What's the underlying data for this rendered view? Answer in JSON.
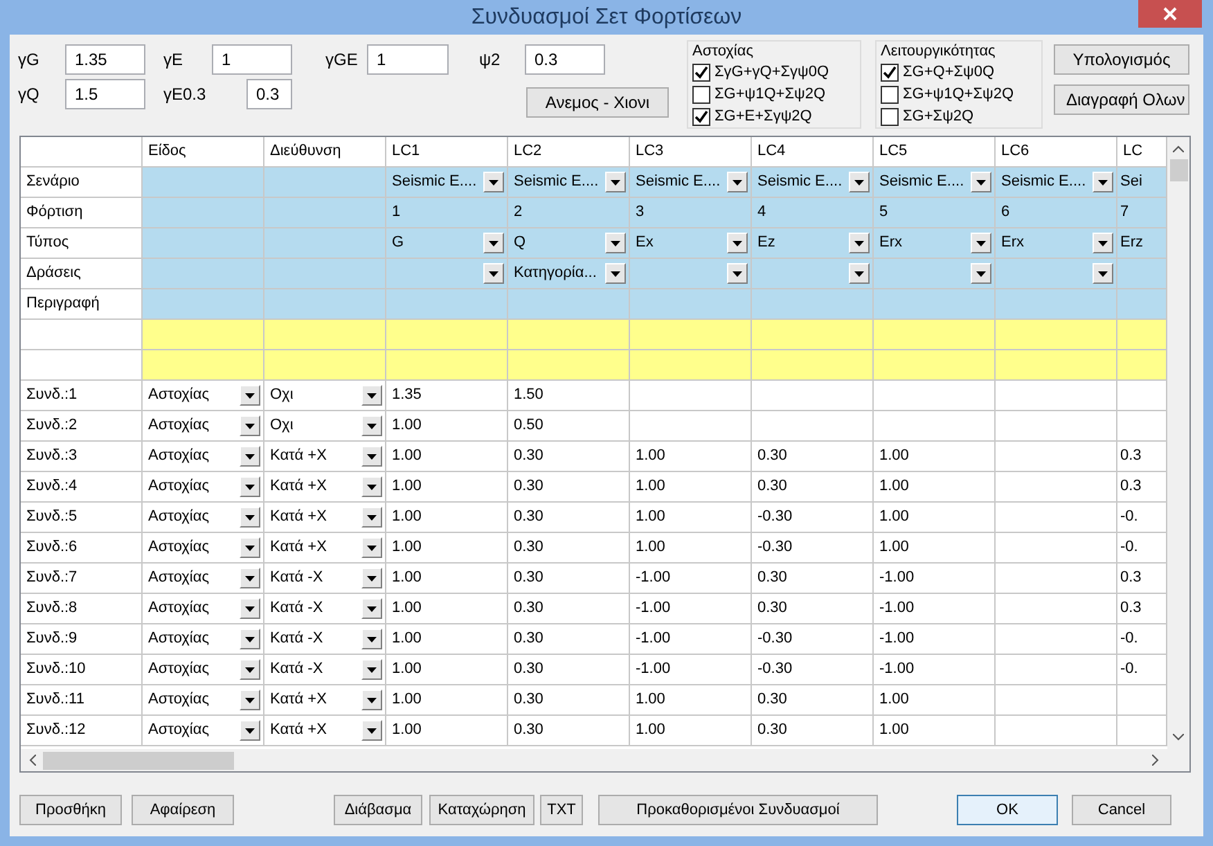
{
  "window": {
    "title": "Συνδυασμοί Σετ Φορτίσεων"
  },
  "factors": [
    {
      "label": "γG",
      "value": "1.35"
    },
    {
      "label": "γQ",
      "value": "1.5"
    },
    {
      "label": "γE",
      "value": "1"
    },
    {
      "label": "γE0.3",
      "value": "0.3"
    },
    {
      "label": "γGE",
      "value": "1"
    },
    {
      "label": "ψ2",
      "value": "0.3"
    }
  ],
  "wind_snow_button": "Ανεμος - Χιονι",
  "groups": [
    {
      "title": "Αστοχίας",
      "options": [
        {
          "label": "ΣγG+γQ+Σγψ0Q",
          "checked": true
        },
        {
          "label": "ΣG+ψ1Q+Σψ2Q",
          "checked": false
        },
        {
          "label": "ΣG+E+Σγψ2Q",
          "checked": true
        }
      ]
    },
    {
      "title": "Λειτουργικότητας",
      "options": [
        {
          "label": "ΣG+Q+Σψ0Q",
          "checked": true
        },
        {
          "label": "ΣG+ψ1Q+Σψ2Q",
          "checked": false
        },
        {
          "label": "ΣG+Σψ2Q",
          "checked": false
        }
      ]
    }
  ],
  "side_buttons": [
    "Υπολογισμός",
    "Διαγραφή Ολων"
  ],
  "table": {
    "columns": [
      "Είδος",
      "Διεύθυνση",
      "LC1",
      "LC2",
      "LC3",
      "LC4",
      "LC5",
      "LC6",
      "LC"
    ],
    "property_rows": [
      {
        "label": "Σενάριο",
        "cells": [
          {
            "kind": "dropdown",
            "text": "Seismic E...."
          },
          {
            "kind": "dropdown",
            "text": "Seismic E...."
          },
          {
            "kind": "dropdown",
            "text": "Seismic E...."
          },
          {
            "kind": "dropdown",
            "text": "Seismic E...."
          },
          {
            "kind": "dropdown",
            "text": "Seismic E...."
          },
          {
            "kind": "dropdown",
            "text": "Seismic E...."
          },
          {
            "kind": "plain",
            "text": "Sei"
          }
        ]
      },
      {
        "label": "Φόρτιση",
        "cells": [
          {
            "kind": "plain",
            "text": "1"
          },
          {
            "kind": "plain",
            "text": "2"
          },
          {
            "kind": "plain",
            "text": "3"
          },
          {
            "kind": "plain",
            "text": "4"
          },
          {
            "kind": "plain",
            "text": "5"
          },
          {
            "kind": "plain",
            "text": "6"
          },
          {
            "kind": "plain",
            "text": "7"
          }
        ]
      },
      {
        "label": "Τύπος",
        "cells": [
          {
            "kind": "dropdown",
            "text": "G"
          },
          {
            "kind": "dropdown",
            "text": "Q"
          },
          {
            "kind": "dropdown",
            "text": "Ex"
          },
          {
            "kind": "dropdown",
            "text": "Ez"
          },
          {
            "kind": "dropdown",
            "text": "Erx"
          },
          {
            "kind": "dropdown",
            "text": "Erx"
          },
          {
            "kind": "plain",
            "text": "Erz"
          }
        ]
      },
      {
        "label": "Δράσεις",
        "cells": [
          {
            "kind": "dropdown"
          },
          {
            "kind": "dropdown",
            "text": "Κατηγορία..."
          },
          {
            "kind": "dropdown"
          },
          {
            "kind": "dropdown"
          },
          {
            "kind": "dropdown"
          },
          {
            "kind": "dropdown"
          },
          {
            "kind": "plain"
          }
        ]
      },
      {
        "label": "Περιγραφή",
        "cells": [
          {
            "kind": "plain"
          },
          {
            "kind": "plain"
          },
          {
            "kind": "plain"
          },
          {
            "kind": "plain"
          },
          {
            "kind": "plain"
          },
          {
            "kind": "plain"
          },
          {
            "kind": "plain"
          }
        ]
      }
    ],
    "rows": [
      {
        "label": "Συνδ.:1",
        "type": "Αστοχίας",
        "direction": "Οχι",
        "values": [
          {
            "kind": "value",
            "text": "1.35"
          },
          {
            "kind": "value",
            "text": "1.50"
          },
          {
            "kind": "blank"
          },
          {
            "kind": "blank"
          },
          {
            "kind": "blank"
          },
          {
            "kind": "blank"
          },
          {
            "kind": "blank"
          }
        ]
      },
      {
        "label": "Συνδ.:2",
        "type": "Αστοχίας",
        "direction": "Οχι",
        "values": [
          {
            "kind": "value",
            "text": "1.00"
          },
          {
            "kind": "value",
            "text": "0.50"
          },
          {
            "kind": "blank"
          },
          {
            "kind": "blank"
          },
          {
            "kind": "blank"
          },
          {
            "kind": "blank"
          },
          {
            "kind": "blank"
          }
        ]
      },
      {
        "label": "Συνδ.:3",
        "type": "Αστοχίας",
        "direction": "Κατά +X",
        "values": [
          {
            "kind": "value",
            "text": "1.00"
          },
          {
            "kind": "value",
            "text": "0.30"
          },
          {
            "kind": "value",
            "text": "1.00"
          },
          {
            "kind": "value",
            "text": "0.30"
          },
          {
            "kind": "value",
            "text": "1.00"
          },
          {
            "kind": "blank"
          },
          {
            "kind": "value",
            "text": "0.3"
          }
        ]
      },
      {
        "label": "Συνδ.:4",
        "type": "Αστοχίας",
        "direction": "Κατά +X",
        "values": [
          {
            "kind": "value",
            "text": "1.00"
          },
          {
            "kind": "value",
            "text": "0.30"
          },
          {
            "kind": "value",
            "text": "1.00"
          },
          {
            "kind": "value",
            "text": "0.30"
          },
          {
            "kind": "value",
            "text": "1.00"
          },
          {
            "kind": "blank"
          },
          {
            "kind": "value",
            "text": "0.3"
          }
        ]
      },
      {
        "label": "Συνδ.:5",
        "type": "Αστοχίας",
        "direction": "Κατά +X",
        "values": [
          {
            "kind": "value",
            "text": "1.00"
          },
          {
            "kind": "value",
            "text": "0.30"
          },
          {
            "kind": "value",
            "text": "1.00"
          },
          {
            "kind": "value",
            "text": "-0.30"
          },
          {
            "kind": "value",
            "text": "1.00"
          },
          {
            "kind": "blank"
          },
          {
            "kind": "value",
            "text": "-0."
          }
        ]
      },
      {
        "label": "Συνδ.:6",
        "type": "Αστοχίας",
        "direction": "Κατά +X",
        "values": [
          {
            "kind": "value",
            "text": "1.00"
          },
          {
            "kind": "value",
            "text": "0.30"
          },
          {
            "kind": "value",
            "text": "1.00"
          },
          {
            "kind": "value",
            "text": "-0.30"
          },
          {
            "kind": "value",
            "text": "1.00"
          },
          {
            "kind": "blank"
          },
          {
            "kind": "value",
            "text": "-0."
          }
        ]
      },
      {
        "label": "Συνδ.:7",
        "type": "Αστοχίας",
        "direction": "Κατά -X",
        "values": [
          {
            "kind": "value",
            "text": "1.00"
          },
          {
            "kind": "value",
            "text": "0.30"
          },
          {
            "kind": "value",
            "text": "-1.00"
          },
          {
            "kind": "value",
            "text": "0.30"
          },
          {
            "kind": "value",
            "text": "-1.00"
          },
          {
            "kind": "blank"
          },
          {
            "kind": "value",
            "text": "0.3"
          }
        ]
      },
      {
        "label": "Συνδ.:8",
        "type": "Αστοχίας",
        "direction": "Κατά -X",
        "values": [
          {
            "kind": "value",
            "text": "1.00"
          },
          {
            "kind": "value",
            "text": "0.30"
          },
          {
            "kind": "value",
            "text": "-1.00"
          },
          {
            "kind": "value",
            "text": "0.30"
          },
          {
            "kind": "value",
            "text": "-1.00"
          },
          {
            "kind": "blank"
          },
          {
            "kind": "value",
            "text": "0.3"
          }
        ]
      },
      {
        "label": "Συνδ.:9",
        "type": "Αστοχίας",
        "direction": "Κατά -X",
        "values": [
          {
            "kind": "value",
            "text": "1.00"
          },
          {
            "kind": "value",
            "text": "0.30"
          },
          {
            "kind": "value",
            "text": "-1.00"
          },
          {
            "kind": "value",
            "text": "-0.30"
          },
          {
            "kind": "value",
            "text": "-1.00"
          },
          {
            "kind": "blank"
          },
          {
            "kind": "value",
            "text": "-0."
          }
        ]
      },
      {
        "label": "Συνδ.:10",
        "type": "Αστοχίας",
        "direction": "Κατά -X",
        "values": [
          {
            "kind": "value",
            "text": "1.00"
          },
          {
            "kind": "value",
            "text": "0.30"
          },
          {
            "kind": "value",
            "text": "-1.00"
          },
          {
            "kind": "value",
            "text": "-0.30"
          },
          {
            "kind": "value",
            "text": "-1.00"
          },
          {
            "kind": "blank"
          },
          {
            "kind": "value",
            "text": "-0."
          }
        ]
      },
      {
        "label": "Συνδ.:11",
        "type": "Αστοχίας",
        "direction": "Κατά +X",
        "values": [
          {
            "kind": "value",
            "text": "1.00"
          },
          {
            "kind": "value",
            "text": "0.30"
          },
          {
            "kind": "value",
            "text": "1.00"
          },
          {
            "kind": "value",
            "text": "0.30"
          },
          {
            "kind": "value",
            "text": "1.00"
          },
          {
            "kind": "blank"
          },
          {
            "kind": "blank"
          }
        ]
      },
      {
        "label": "Συνδ.:12",
        "type": "Αστοχίας",
        "direction": "Κατά +X",
        "values": [
          {
            "kind": "value",
            "text": "1.00"
          },
          {
            "kind": "value",
            "text": "0.30"
          },
          {
            "kind": "value",
            "text": "1.00"
          },
          {
            "kind": "value",
            "text": "0.30"
          },
          {
            "kind": "value",
            "text": "1.00"
          },
          {
            "kind": "blank"
          },
          {
            "kind": "blank"
          }
        ]
      }
    ]
  },
  "bottom_buttons": [
    {
      "label": "Προσθήκη",
      "kind": "normal"
    },
    {
      "label": "Αφαίρεση",
      "kind": "normal"
    },
    {
      "label": "Διάβασμα",
      "kind": "normal"
    },
    {
      "label": "Καταχώρηση",
      "kind": "normal"
    },
    {
      "label": "TXT",
      "kind": "normal"
    },
    {
      "label": "Προκαθορισμένοι Συνδυασμοί",
      "kind": "normal"
    },
    {
      "label": "OK",
      "kind": "default"
    },
    {
      "label": "Cancel",
      "kind": "normal"
    }
  ]
}
